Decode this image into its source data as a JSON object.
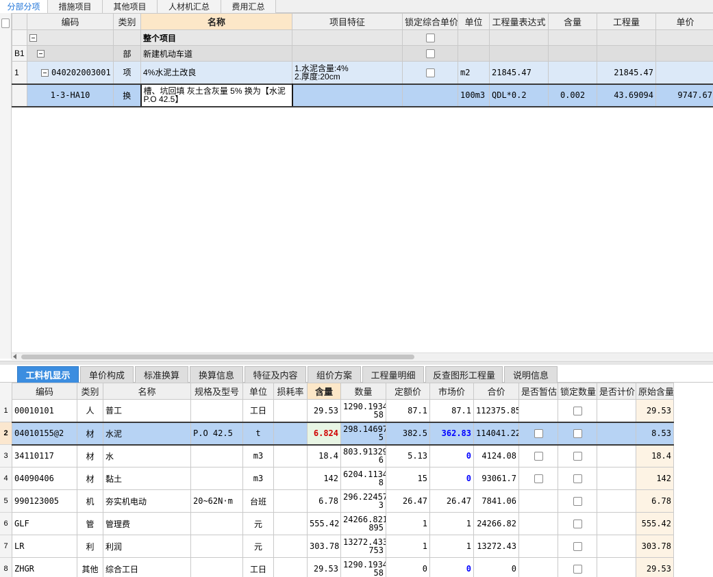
{
  "top_tabs": [
    {
      "label": "分部分项",
      "active": true
    },
    {
      "label": "措施项目",
      "active": false
    },
    {
      "label": "其他项目",
      "active": false
    },
    {
      "label": "人材机汇总",
      "active": false
    },
    {
      "label": "费用汇总",
      "active": false
    }
  ],
  "upper": {
    "headers": [
      "编码",
      "类别",
      "名称",
      "项目特征",
      "锁定综合单价",
      "单位",
      "工程量表达式",
      "含量",
      "工程量",
      "单价"
    ],
    "whole_project": {
      "name": "整个项目"
    },
    "part": {
      "row_label": "B1",
      "type": "部",
      "name": "新建机动车道"
    },
    "item": {
      "row_label": "1",
      "code": "040202003001",
      "type": "项",
      "name": "4%水泥土改良",
      "feature_line1": "1.水泥含量:4%",
      "feature_line2": "2.厚度:20cm",
      "unit": "m2",
      "expr": "21845.47",
      "quantity": "21845.47"
    },
    "sub": {
      "code": "1-3-HA10",
      "type": "换",
      "name": "槽、坑回填 灰土含灰量 5%  换为【水泥 P.O 42.5】",
      "unit": "100m3",
      "expr": "QDL*0.2",
      "content": "0.002",
      "quantity": "43.69094",
      "price": "9747.67"
    }
  },
  "bottom_tabs": [
    {
      "label": "工料机显示",
      "active": true
    },
    {
      "label": "单价构成",
      "active": false
    },
    {
      "label": "标准换算",
      "active": false
    },
    {
      "label": "换算信息",
      "active": false
    },
    {
      "label": "特征及内容",
      "active": false
    },
    {
      "label": "组价方案",
      "active": false
    },
    {
      "label": "工程量明细",
      "active": false
    },
    {
      "label": "反查图形工程量",
      "active": false
    },
    {
      "label": "说明信息",
      "active": false
    }
  ],
  "lower": {
    "headers": [
      "编码",
      "类别",
      "名称",
      "规格及型号",
      "单位",
      "损耗率",
      "含量",
      "数量",
      "定额价",
      "市场价",
      "合价",
      "是否暂估",
      "锁定数量",
      "是否计价",
      "原始含量"
    ],
    "rows": [
      {
        "no": "1",
        "code": "00010101",
        "type": "人",
        "name": "普工",
        "spec": "",
        "unit": "工日",
        "loss": "",
        "content": "29.53",
        "qty1": "1290.1934",
        "qty2": "58",
        "base": "87.1",
        "market": "87.1",
        "total": "112375.85",
        "est": false,
        "lock": true,
        "priced": false,
        "orig": "29.53"
      },
      {
        "no": "2",
        "code": "04010155@2",
        "type": "材",
        "name": "水泥",
        "spec": "P.O 42.5",
        "unit": "t",
        "loss": "",
        "content": "6.824",
        "qty1": "298.14697",
        "qty2": "5",
        "base": "382.5",
        "market": "362.83",
        "total": "114041.22",
        "est": true,
        "lock": true,
        "priced": false,
        "orig": "8.53"
      },
      {
        "no": "3",
        "code": "34110117",
        "type": "材",
        "name": "水",
        "spec": "",
        "unit": "m3",
        "loss": "",
        "content": "18.4",
        "qty1": "803.91329",
        "qty2": "6",
        "base": "5.13",
        "market": "0",
        "total": "4124.08",
        "est": true,
        "lock": true,
        "priced": false,
        "orig": "18.4"
      },
      {
        "no": "4",
        "code": "04090406",
        "type": "材",
        "name": "黏土",
        "spec": "",
        "unit": "m3",
        "loss": "",
        "content": "142",
        "qty1": "6204.1134",
        "qty2": "8",
        "base": "15",
        "market": "0",
        "total": "93061.7",
        "est": true,
        "lock": true,
        "priced": false,
        "orig": "142"
      },
      {
        "no": "5",
        "code": "990123005",
        "type": "机",
        "name": "夯实机电动",
        "spec": "20~62N·m",
        "unit": "台班",
        "loss": "",
        "content": "6.78",
        "qty1": "296.22457",
        "qty2": "3",
        "base": "26.47",
        "market": "26.47",
        "total": "7841.06",
        "est": false,
        "lock": true,
        "priced": false,
        "orig": "6.78"
      },
      {
        "no": "6",
        "code": "GLF",
        "type": "管",
        "name": "管理费",
        "spec": "",
        "unit": "元",
        "loss": "",
        "content": "555.42",
        "qty1": "24266.821",
        "qty2": "895",
        "base": "1",
        "market": "1",
        "total": "24266.82",
        "est": false,
        "lock": true,
        "priced": false,
        "orig": "555.42"
      },
      {
        "no": "7",
        "code": "LR",
        "type": "利",
        "name": "利润",
        "spec": "",
        "unit": "元",
        "loss": "",
        "content": "303.78",
        "qty1": "13272.433",
        "qty2": "753",
        "base": "1",
        "market": "1",
        "total": "13272.43",
        "est": false,
        "lock": true,
        "priced": false,
        "orig": "303.78"
      },
      {
        "no": "8",
        "code": "ZHGR",
        "type": "其他",
        "name": "综合工日",
        "spec": "",
        "unit": "工日",
        "loss": "",
        "content": "29.53",
        "qty1": "1290.1934",
        "qty2": "58",
        "base": "0",
        "market": "0",
        "total": "0",
        "est": false,
        "lock": true,
        "priced": false,
        "orig": "29.53"
      }
    ]
  },
  "icons": {
    "tree_toggle": "collapse-icon",
    "checkbox": "checkbox-icon",
    "scroll_left": "arrow-left-icon"
  }
}
